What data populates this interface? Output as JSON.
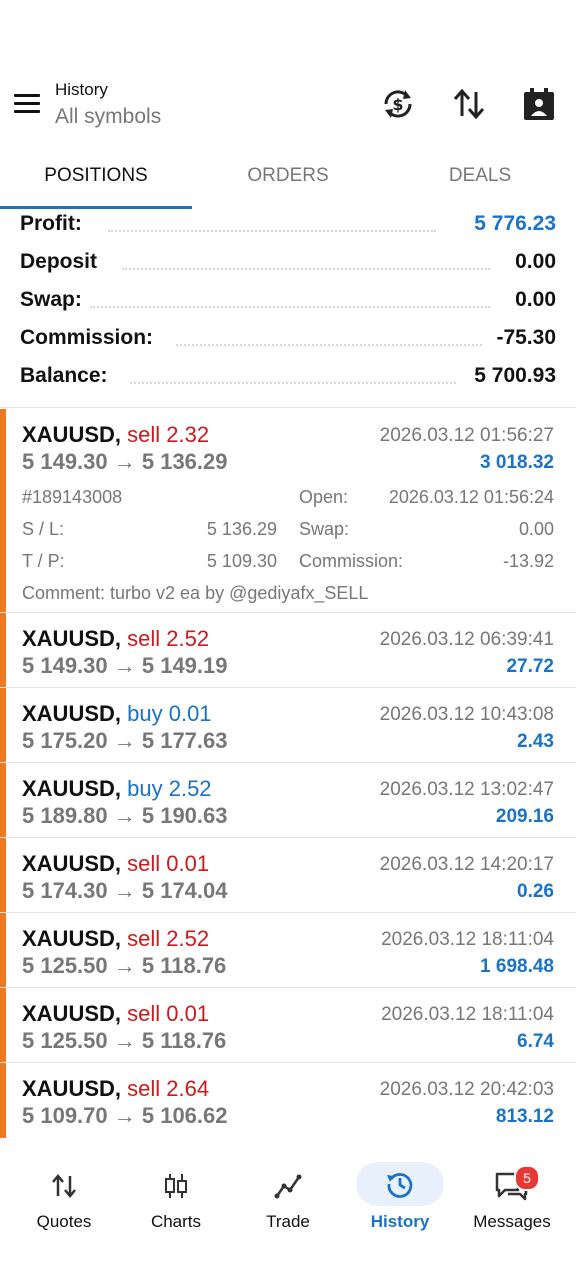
{
  "header": {
    "title": "History",
    "subtitle": "All symbols"
  },
  "tabs": [
    {
      "label": "POSITIONS"
    },
    {
      "label": "ORDERS"
    },
    {
      "label": "DEALS"
    }
  ],
  "summary": {
    "profit_label": "Profit:",
    "profit_value": "5 776.23",
    "deposit_label": "Deposit",
    "deposit_value": "0.00",
    "swap_label": "Swap:",
    "swap_value": "0.00",
    "commission_label": "Commission:",
    "commission_value": "-75.30",
    "balance_label": "Balance:",
    "balance_value": "5 700.93"
  },
  "positions": [
    {
      "symbol": "XAUUSD,",
      "side": "sell 2.32",
      "prices": "5 149.30 → 5 136.29",
      "time": "2026.03.12 01:56:27",
      "profit": "3 018.32",
      "ticket": "#189143008",
      "open_label": "Open:",
      "open_value": "2026.03.12 01:56:24",
      "sl_label": "S / L:",
      "sl_value": "5 136.29",
      "swap_label": "Swap:",
      "swap_value": "0.00",
      "tp_label": "T / P:",
      "tp_value": "5 109.30",
      "commission_label": "Commission:",
      "commission_value": "-13.92",
      "comment_label": "Comment:",
      "comment_value": "turbo v2 ea by @gediyafx_SELL"
    },
    {
      "symbol": "XAUUSD,",
      "side": "sell 2.52",
      "prices": "5 149.30 → 5 149.19",
      "time": "2026.03.12 06:39:41",
      "profit": "27.72"
    },
    {
      "symbol": "XAUUSD,",
      "side": "buy 0.01",
      "prices": "5 175.20 → 5 177.63",
      "time": "2026.03.12 10:43:08",
      "profit": "2.43"
    },
    {
      "symbol": "XAUUSD,",
      "side": "buy 2.52",
      "prices": "5 189.80 → 5 190.63",
      "time": "2026.03.12 13:02:47",
      "profit": "209.16"
    },
    {
      "symbol": "XAUUSD,",
      "side": "sell 0.01",
      "prices": "5 174.30 → 5 174.04",
      "time": "2026.03.12 14:20:17",
      "profit": "0.26"
    },
    {
      "symbol": "XAUUSD,",
      "side": "sell 2.52",
      "prices": "5 125.50 → 5 118.76",
      "time": "2026.03.12 18:11:04",
      "profit": "1 698.48"
    },
    {
      "symbol": "XAUUSD,",
      "side": "sell 0.01",
      "prices": "5 125.50 → 5 118.76",
      "time": "2026.03.12 18:11:04",
      "profit": "6.74"
    },
    {
      "symbol": "XAUUSD,",
      "side": "sell 2.64",
      "prices": "5 109.70 → 5 106.62",
      "time": "2026.03.12 20:42:03",
      "profit": "813.12"
    }
  ],
  "bottom_nav": [
    {
      "label": "Quotes",
      "icon": "quotes-icon"
    },
    {
      "label": "Charts",
      "icon": "charts-icon"
    },
    {
      "label": "Trade",
      "icon": "trade-icon"
    },
    {
      "label": "History",
      "icon": "history-icon"
    },
    {
      "label": "Messages",
      "icon": "messages-icon",
      "badge": "5"
    }
  ],
  "colors": {
    "accent": "#1a73c8",
    "sell": "#cc1a1a",
    "buy": "#1a73c8",
    "position_bar": "#f07820",
    "badge": "#e53935",
    "active_nav_bg": "#e8f1fb"
  }
}
